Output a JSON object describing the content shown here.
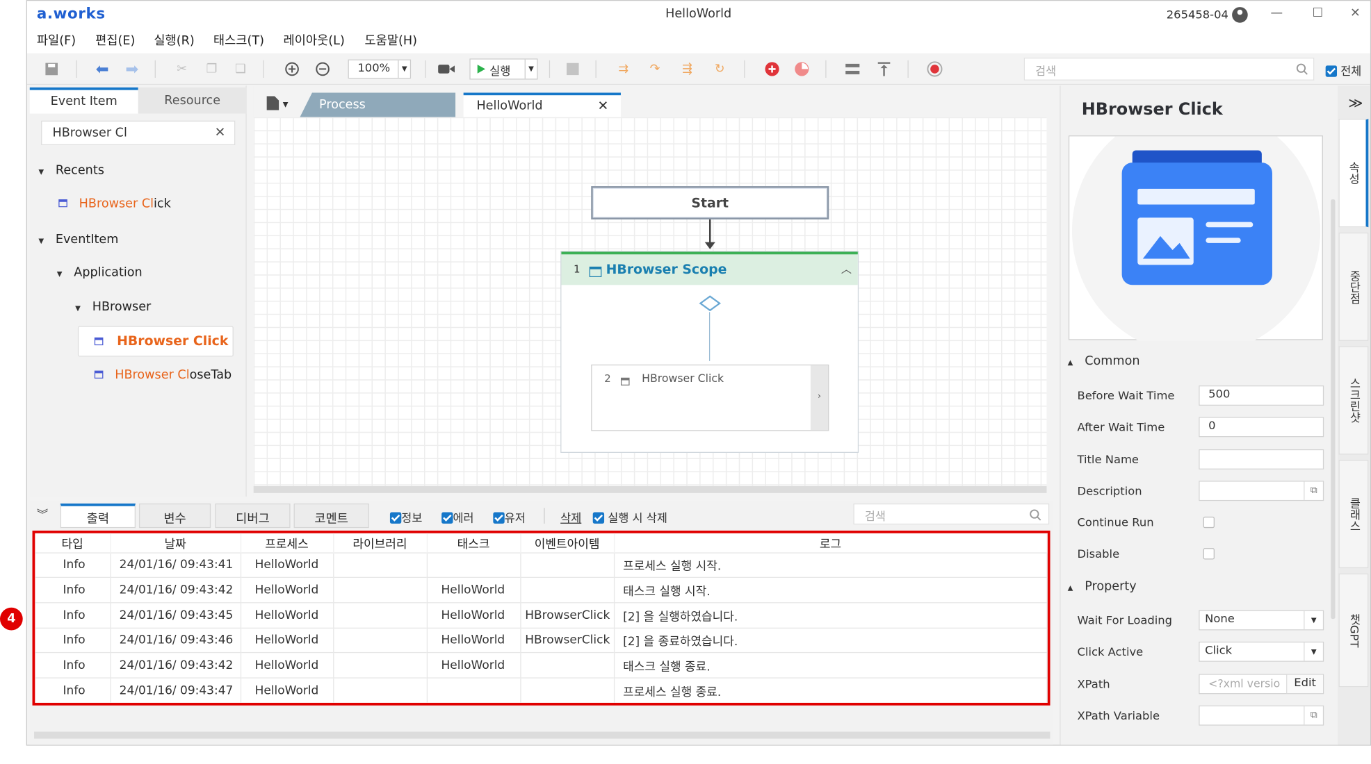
{
  "app": {
    "logo": "a.works",
    "title": "HelloWorld",
    "user_id": "265458-04"
  },
  "menu": [
    "파일(F)",
    "편집(E)",
    "실행(R)",
    "태스크(T)",
    "레이아웃(L)",
    "도움말(H)"
  ],
  "toolbar": {
    "zoom": "100%",
    "run_label": "실행",
    "search_placeholder": "검색",
    "all_label": "전체"
  },
  "left_panel": {
    "tabs": [
      "Event Item",
      "Resource"
    ],
    "search_value": "HBrowser Cl",
    "recents_label": "Recents",
    "recent_item": {
      "prefix": "HBrowser Cl",
      "suffix": "ick"
    },
    "eventitem_label": "EventItem",
    "application_label": "Application",
    "hbrowser_label": "HBrowser",
    "selected_item": "HBrowser Click",
    "closetab_item": {
      "prefix": "HBrowser Cl",
      "suffix": "oseTab"
    }
  },
  "canvas": {
    "tabs": [
      "Process",
      "HelloWorld"
    ],
    "start_label": "Start",
    "scope": {
      "index": "1",
      "title": "HBrowser Scope"
    },
    "inner": {
      "index": "2",
      "title": "HBrowser Click"
    }
  },
  "properties": {
    "title": "HBrowser Click",
    "common_label": "Common",
    "before_wait_label": "Before Wait Time",
    "before_wait_value": "500",
    "after_wait_label": "After Wait Time",
    "after_wait_value": "0",
    "title_name_label": "Title Name",
    "description_label": "Description",
    "continue_run_label": "Continue Run",
    "disable_label": "Disable",
    "property_label": "Property",
    "wait_loading_label": "Wait For Loading",
    "wait_loading_value": "None",
    "click_active_label": "Click Active",
    "click_active_value": "Click",
    "xpath_label": "XPath",
    "xpath_placeholder": "<?xml versio",
    "edit_label": "Edit",
    "xpath_var_label": "XPath Variable"
  },
  "side_tabs": [
    "속성",
    "중단점",
    "스크린샷",
    "클래스",
    "챗GPT"
  ],
  "output": {
    "tabs": [
      "출력",
      "변수",
      "디버그",
      "코멘트"
    ],
    "filters": [
      "정보",
      "에러",
      "유저"
    ],
    "delete_label": "삭제",
    "delete_on_run_label": "실행 시 삭제",
    "search_placeholder": "검색",
    "columns": [
      "타입",
      "날짜",
      "프로세스",
      "라이브러리",
      "태스크",
      "이벤트아이템",
      "로그"
    ],
    "rows": [
      [
        "Info",
        "24/01/16/ 09:43:41",
        "HelloWorld",
        "",
        "",
        "",
        "프로세스 실행 시작."
      ],
      [
        "Info",
        "24/01/16/ 09:43:42",
        "HelloWorld",
        "",
        "HelloWorld",
        "",
        "태스크 실행 시작."
      ],
      [
        "Info",
        "24/01/16/ 09:43:45",
        "HelloWorld",
        "",
        "HelloWorld",
        "HBrowserClick",
        "[2] 을 실행하였습니다."
      ],
      [
        "Info",
        "24/01/16/ 09:43:46",
        "HelloWorld",
        "",
        "HelloWorld",
        "HBrowserClick",
        "[2] 을 종료하였습니다."
      ],
      [
        "Info",
        "24/01/16/ 09:43:42",
        "HelloWorld",
        "",
        "HelloWorld",
        "",
        "태스크 실행 종료."
      ],
      [
        "Info",
        "24/01/16/ 09:43:47",
        "HelloWorld",
        "",
        "",
        "",
        "프로세스 실행 종료."
      ]
    ]
  },
  "annotation_number": "4"
}
